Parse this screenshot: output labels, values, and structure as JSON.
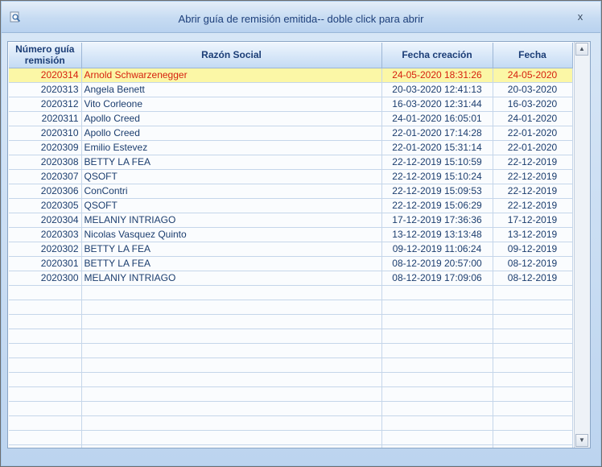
{
  "window": {
    "title": "Abrir guía de remisión emitida-- doble click para abrir",
    "close_glyph": "x",
    "icon": "search-document-icon"
  },
  "grid": {
    "columns": [
      "Número guía remisión",
      "Razón Social",
      "Fecha creación",
      "Fecha"
    ],
    "rows": [
      [
        "2020314",
        "Arnold Schwarzenegger",
        "24-05-2020 18:31:26",
        "24-05-2020"
      ],
      [
        "2020313",
        "Angela Benett",
        "20-03-2020 12:41:13",
        "20-03-2020"
      ],
      [
        "2020312",
        "Vito Corleone",
        "16-03-2020 12:31:44",
        "16-03-2020"
      ],
      [
        "2020311",
        "Apollo Creed",
        "24-01-2020 16:05:01",
        "24-01-2020"
      ],
      [
        "2020310",
        "Apollo Creed",
        "22-01-2020 17:14:28",
        "22-01-2020"
      ],
      [
        "2020309",
        "Emilio Estevez",
        "22-01-2020 15:31:14",
        "22-01-2020"
      ],
      [
        "2020308",
        "BETTY LA FEA",
        "22-12-2019 15:10:59",
        "22-12-2019"
      ],
      [
        "2020307",
        "QSOFT",
        "22-12-2019 15:10:24",
        "22-12-2019"
      ],
      [
        "2020306",
        "ConContri",
        "22-12-2019 15:09:53",
        "22-12-2019"
      ],
      [
        "2020305",
        "QSOFT",
        "22-12-2019 15:06:29",
        "22-12-2019"
      ],
      [
        "2020304",
        "MELANIY INTRIAGO",
        "17-12-2019 17:36:36",
        "17-12-2019"
      ],
      [
        "2020303",
        "Nicolas Vasquez Quinto",
        "13-12-2019 13:13:48",
        "13-12-2019"
      ],
      [
        "2020302",
        "BETTY LA FEA",
        "09-12-2019 11:06:24",
        "09-12-2019"
      ],
      [
        "2020301",
        "BETTY LA FEA",
        "08-12-2019 20:57:00",
        "08-12-2019"
      ],
      [
        "2020300",
        "MELANIY INTRIAGO",
        "08-12-2019 17:09:06",
        "08-12-2019"
      ]
    ],
    "selected_row": 0,
    "empty_rows": 12
  },
  "colors": {
    "selected_background": "#fbf7a6",
    "selected_text": "#d6200e",
    "header_text": "#1b3d76",
    "cell_text": "#1b3d6e"
  },
  "scrollbar": {
    "up_glyph": "▲",
    "down_glyph": "▼"
  }
}
